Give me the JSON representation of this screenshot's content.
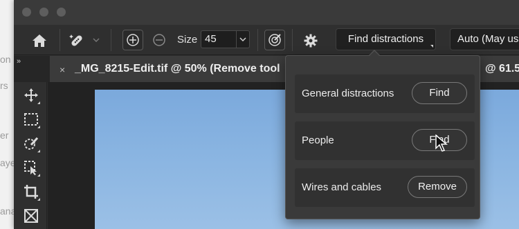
{
  "document": {
    "tab_title": "_MG_8215-Edit.tif @ 50% (Remove tool",
    "tab_close": "×",
    "other_tab_title": "@ 61.5",
    "collapse_glyph": "»"
  },
  "options_bar": {
    "size_label": "Size",
    "size_value": "45",
    "find_distractions_label": "Find distractions",
    "mode_label": "Auto (May us"
  },
  "popover": {
    "rows": [
      {
        "label": "General distractions",
        "button": "Find"
      },
      {
        "label": "People",
        "button": "Find"
      },
      {
        "label": "Wires and cables",
        "button": "Remove"
      }
    ]
  },
  "background_panel": {
    "ghost_texts": [
      "on",
      "rs",
      "er",
      "aye",
      "ana"
    ]
  },
  "toolbar": {
    "tools": [
      "move-icon",
      "marquee-icon",
      "quick-selection-icon",
      "object-selection-icon",
      "crop-icon",
      "frame-icon"
    ]
  },
  "colors": {
    "app_bg": "#2d2d2d",
    "popover_bg": "#3a3a3a",
    "sky_top": "#7ba9dc",
    "sky_bottom": "#9bc0e6"
  }
}
